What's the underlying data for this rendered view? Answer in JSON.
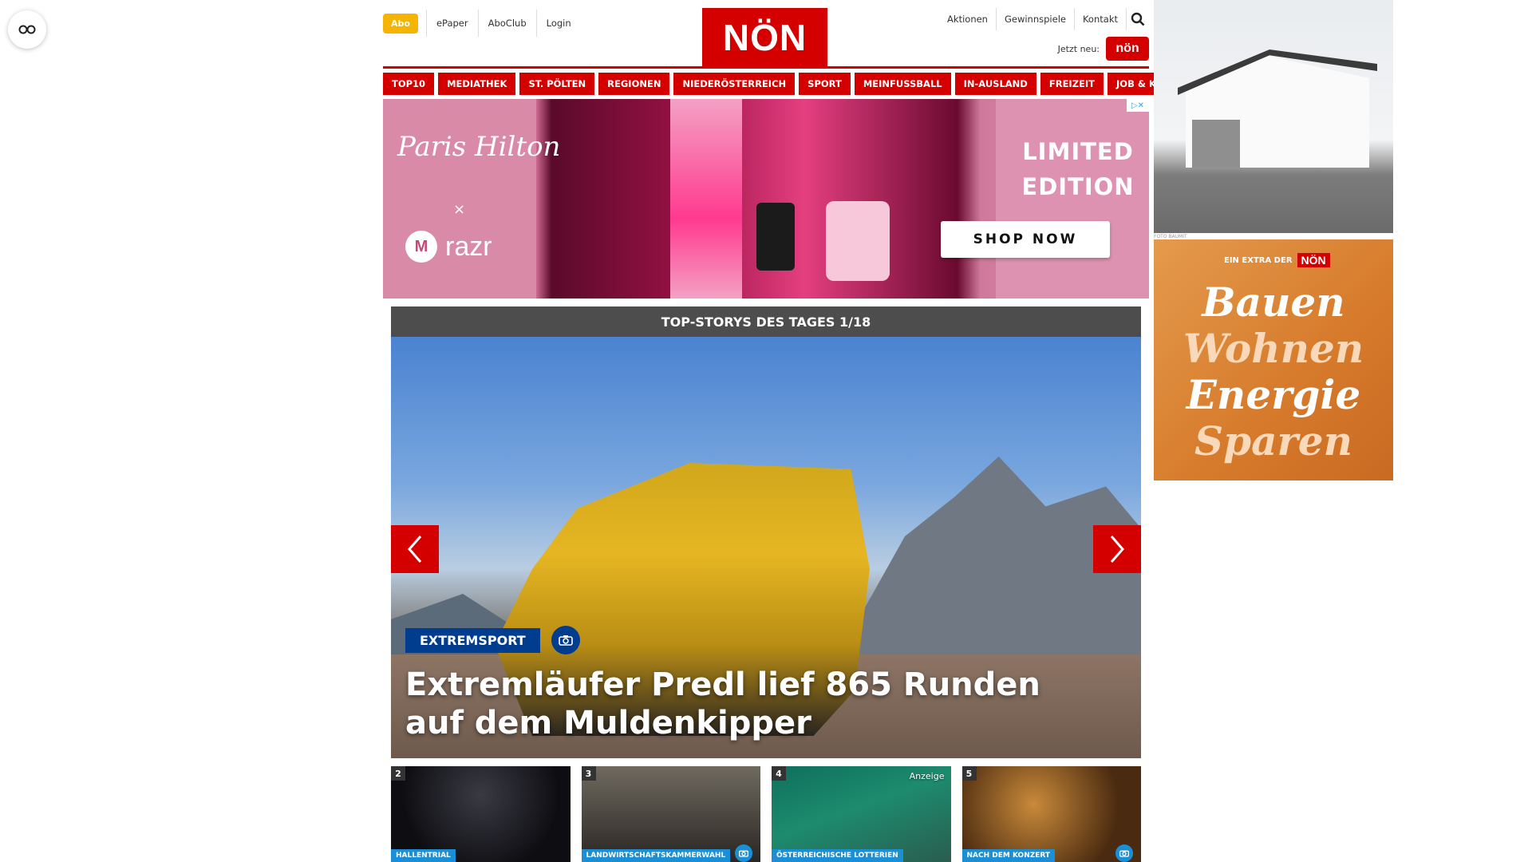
{
  "accessibility": {
    "icon": "glasses-icon"
  },
  "header": {
    "abo": "Abo",
    "links": [
      "ePaper",
      "AboClub",
      "Login"
    ],
    "logo": "NÖN",
    "right_links": [
      "Aktionen",
      "Gewinnspiele",
      "Kontakt"
    ],
    "search_icon": "search-icon",
    "jetzt_neu": "Jetzt neu:",
    "jetzt_badge": "nön"
  },
  "mainnav": [
    "TOP10",
    "MEDIATHEK",
    "ST. PÖLTEN",
    "REGIONEN",
    "NIEDERÖSTERREICH",
    "SPORT",
    "MEINFUSSBALL",
    "IN-AUSLAND",
    "FREIZEIT",
    "JOB & KARRIERE"
  ],
  "banner": {
    "brand": "Paris Hilton",
    "x": "×",
    "razr": "razr",
    "limited": "LIMITED EDITION",
    "shop": "SHOP NOW"
  },
  "slider": {
    "title": "TOP-STORYS DES TAGES 1/18",
    "category": "EXTREMSPORT",
    "headline": "Extremläufer Predl lief 865 Runden auf dem Muldenkipper"
  },
  "thumbs": [
    {
      "num": "2",
      "cat": "HALLENTRIAL",
      "anz": ""
    },
    {
      "num": "3",
      "cat": "LANDWIRTSCHAFTSKAMMERWAHL",
      "anz": ""
    },
    {
      "num": "4",
      "cat": "ÖSTERREICHISCHE LOTTERIEN",
      "anz": "Anzeige"
    },
    {
      "num": "5",
      "cat": "NACH DEM KONZERT",
      "anz": ""
    }
  ],
  "right_ads": {
    "foto": "FOTO BAUMIT",
    "extra": "EIN EXTRA DER",
    "extra_logo": "NÖN",
    "words": [
      "Bauen",
      "Wohnen",
      "Energie",
      "Sparen"
    ]
  }
}
